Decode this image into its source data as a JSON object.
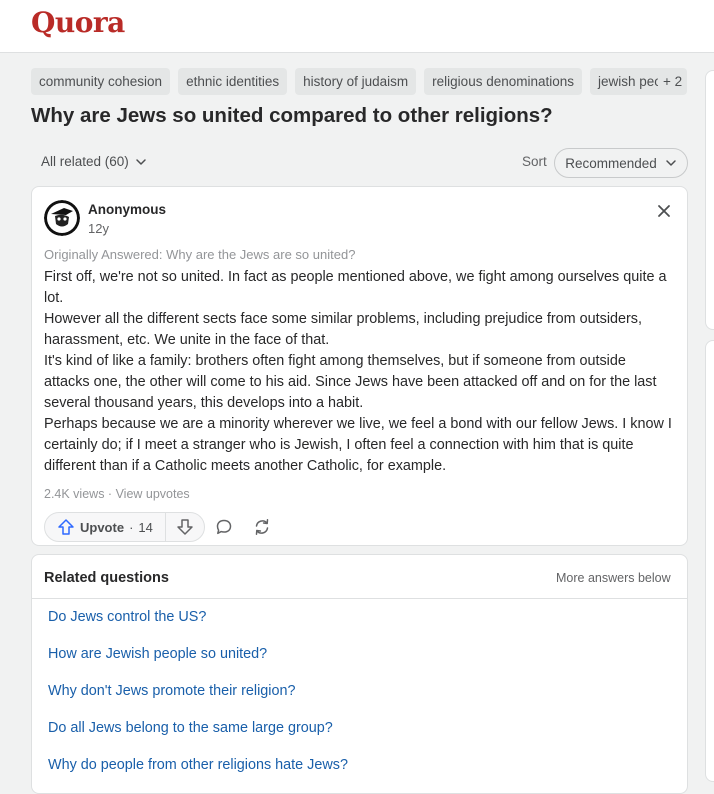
{
  "app": {
    "logo": "Quora",
    "brand_color": "#b92b27"
  },
  "topics": {
    "items": [
      "community cohesion",
      "ethnic identities",
      "history of judaism",
      "religious denominations",
      "jewish peop"
    ],
    "more": "+ 2"
  },
  "question": {
    "title": "Why are Jews so united compared to other religions?"
  },
  "filter": {
    "all_related": "All related (60)",
    "sort_label": "Sort",
    "sort_value": "Recommended"
  },
  "answer": {
    "author": "Anonymous",
    "age": "12y",
    "originally_answered": "Originally Answered: Why are the Jews are so united?",
    "paragraphs": [
      "First off, we're not so united. In fact as people mentioned above, we fight among ourselves quite a lot.",
      "However all the different sects face some similar problems, including prejudice from outsiders, harassment, etc. We unite in the face of that.",
      "It's kind of like a family: brothers often fight among themselves, but if someone from outside attacks one, the other will come to his aid. Since Jews have been attacked off and on for the last several thousand years, this develops into a habit.",
      "Perhaps because we are a minority wherever we live, we feel a bond with our fellow Jews. I know I certainly do; if I meet a stranger who is Jewish, I often feel a connection with him that is quite different than if a Catholic meets another Catholic, for example."
    ],
    "views": "2.4K views",
    "separator": " · ",
    "view_upvotes": "View upvotes",
    "upvote_label": "Upvote",
    "upvote_sep": " · ",
    "upvote_count": "14"
  },
  "related": {
    "title": "Related questions",
    "more_answers": "More answers below",
    "questions": [
      "Do Jews control the US?",
      "How are Jewish people so united?",
      "Why don't Jews promote their religion?",
      "Do all Jews belong to the same large group?",
      "Why do people from other religions hate Jews?"
    ]
  }
}
